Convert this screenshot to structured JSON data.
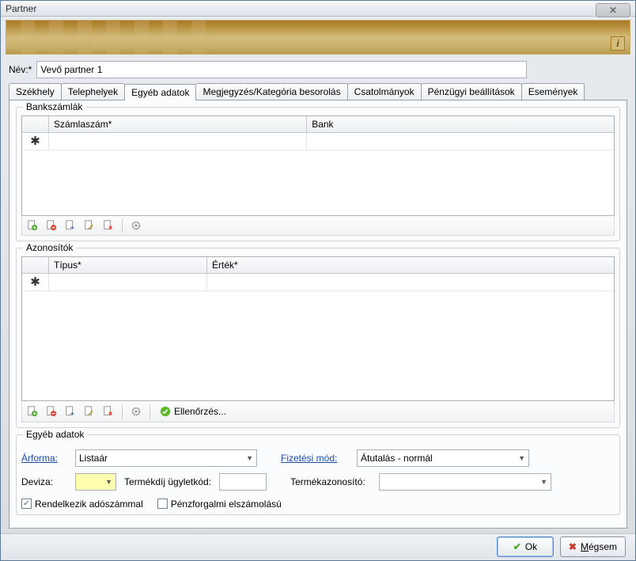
{
  "window": {
    "title": "Partner"
  },
  "name": {
    "label": "Név:*",
    "value": "Vevő partner 1"
  },
  "tabs": [
    {
      "label": "Székhely"
    },
    {
      "label": "Telephelyek"
    },
    {
      "label": "Egyéb adatok"
    },
    {
      "label": "Megjegyzés/Kategória besorolás"
    },
    {
      "label": "Csatolmányok"
    },
    {
      "label": "Pénzügyi beállítások"
    },
    {
      "label": "Események"
    }
  ],
  "active_tab": 2,
  "bank": {
    "title": "Bankszámlák",
    "columns": {
      "account": "Számlaszám*",
      "bank": "Bank"
    },
    "new_marker": "✱"
  },
  "ids": {
    "title": "Azonosítók",
    "columns": {
      "type": "Típus*",
      "value": "Érték*"
    },
    "new_marker": "✱",
    "check_label": "Ellenőrzés..."
  },
  "misc": {
    "title": "Egyéb adatok",
    "arforma_label": "Árforma:",
    "arforma_value": "Listaár",
    "fizmod_label": "Fizetési mód:",
    "fizmod_value": "Átutalás - normál",
    "deviza_label": "Deviza:",
    "deviza_value": "",
    "termekdij_label": "Termékdíj ügyletkód:",
    "termekdij_value": "",
    "termekazon_label": "Termékazonosító:",
    "termekazon_value": "",
    "adoszam_label": "Rendelkezik adószámmal",
    "adoszam_checked": true,
    "penzforgalmi_label": "Pénzforgalmi elszámolású",
    "penzforgalmi_checked": false
  },
  "buttons": {
    "ok": "Ok",
    "cancel": "Mégsem"
  },
  "info_icon": "i"
}
